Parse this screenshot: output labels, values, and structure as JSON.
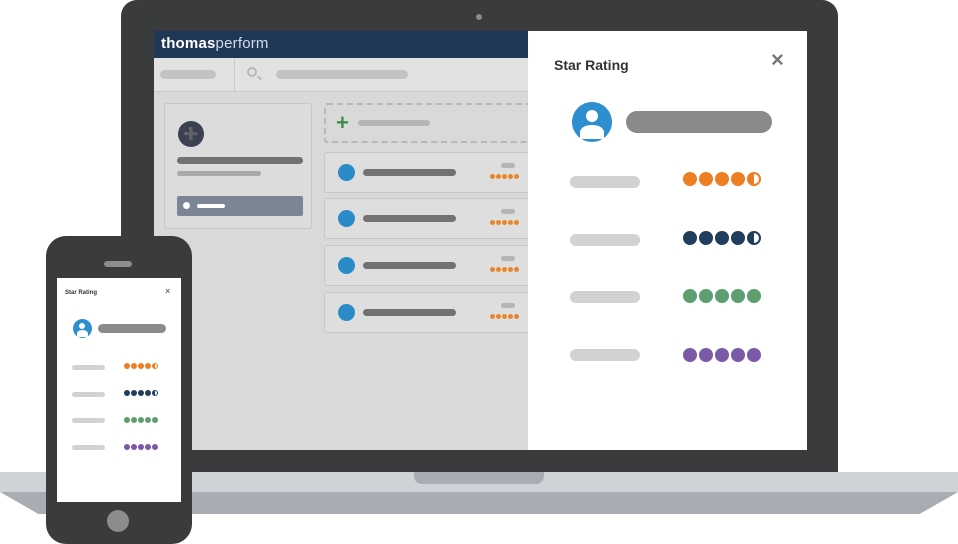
{
  "app": {
    "brand_bold": "thomas",
    "brand_light": "perform"
  },
  "modal": {
    "title": "Star Rating",
    "close_glyph": "×"
  },
  "ratings": [
    {
      "color": "#ee7e22",
      "filled": 4,
      "half": true
    },
    {
      "color": "#213d5e",
      "filled": 4,
      "half": true
    },
    {
      "color": "#5e9e6e",
      "filled": 5,
      "half": false
    },
    {
      "color": "#7b59a8",
      "filled": 5,
      "half": false
    }
  ],
  "list_rows": 4,
  "colors": {
    "header": "#1f3858",
    "accent_blue": "#2d8fd0",
    "device": "#3a3b3d"
  },
  "icons": [
    "add-user-icon",
    "search-icon",
    "plus-icon",
    "close-icon",
    "user-avatar-icon",
    "info-icon"
  ]
}
